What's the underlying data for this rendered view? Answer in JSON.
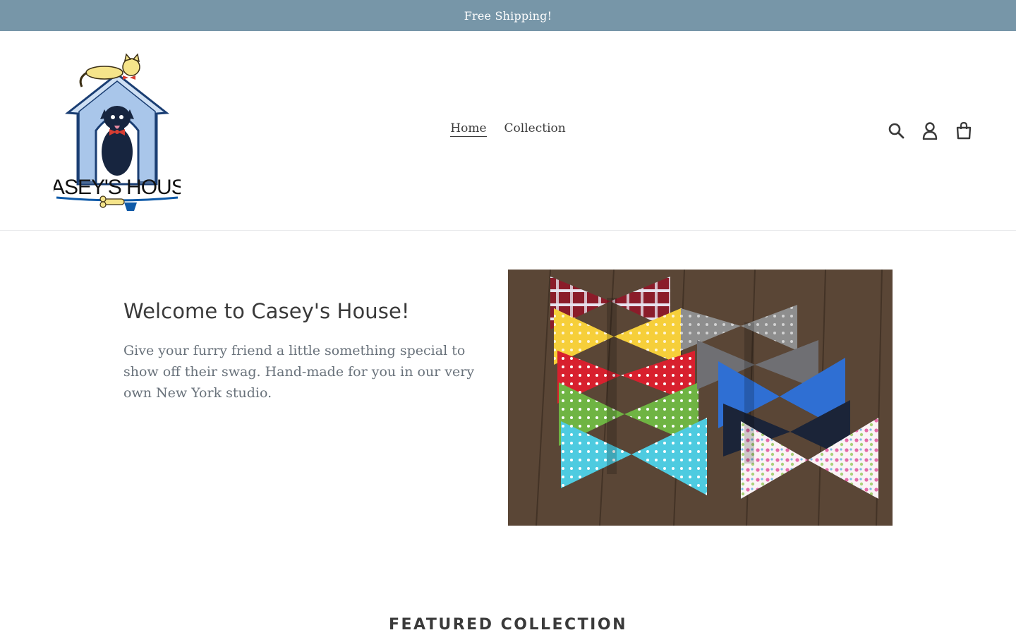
{
  "announcement": {
    "text": "Free Shipping!"
  },
  "header": {
    "logo_text": "CASEY'S HOUSE",
    "nav": [
      {
        "label": "Home",
        "active": true
      },
      {
        "label": "Collection",
        "active": false
      }
    ],
    "icons": [
      "search-icon",
      "account-icon",
      "cart-icon"
    ]
  },
  "hero": {
    "title": "Welcome to Casey's House!",
    "body": "Give your furry friend a little something special to show off their swag.  Hand-made for you in our very own New York studio.",
    "image_subject": "assortment of colorful bow ties on wooden planks"
  },
  "featured": {
    "title": "FEATURED COLLECTION"
  },
  "colors": {
    "announcement_bg": "#7796a8",
    "text": "#3a3a3a",
    "muted_text": "#69727b",
    "logo_blue": "#0f5aa8"
  }
}
